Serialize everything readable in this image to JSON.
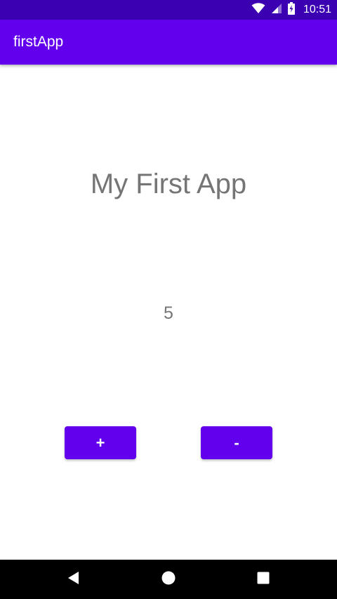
{
  "status_bar": {
    "time": "10:51",
    "icons": [
      "wifi-icon",
      "cellular-signal-icon",
      "battery-charging-icon"
    ]
  },
  "app_bar": {
    "title": "firstApp"
  },
  "main": {
    "heading": "My First App",
    "counter_value": "5",
    "increment_label": "+",
    "decrement_label": "-"
  },
  "nav_bar": {
    "icons": [
      "back-icon",
      "home-icon",
      "recents-icon"
    ]
  },
  "colors": {
    "status_bar": "#3a00b2",
    "primary": "#6200ee",
    "text_secondary": "#757575",
    "nav_bar": "#000000"
  }
}
